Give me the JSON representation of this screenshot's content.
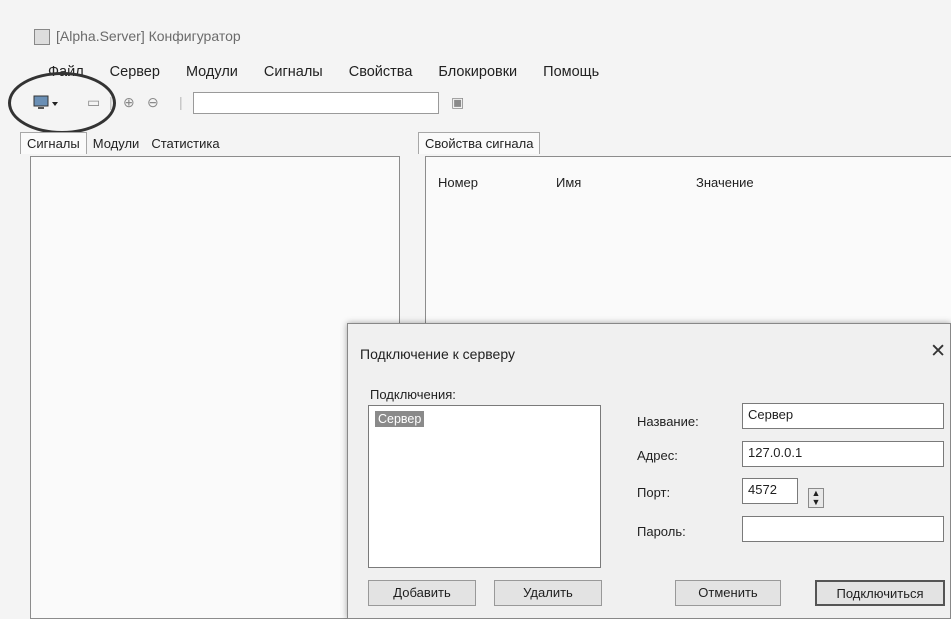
{
  "window": {
    "title": "[Alpha.Server] Конфигуратор"
  },
  "menu": {
    "items": [
      "Файл",
      "Сервер",
      "Модули",
      "Сигналы",
      "Свойства",
      "Блокировки",
      "Помощь"
    ]
  },
  "left_tabs": [
    "Сигналы",
    "Модули",
    "Статистика"
  ],
  "right": {
    "tab": "Свойства сигнала",
    "columns": [
      "Номер",
      "Имя",
      "Значение"
    ]
  },
  "dialog": {
    "title": "Подключение к серверу",
    "connections_label": "Подключения:",
    "connections": [
      "Сервер"
    ],
    "fields": {
      "name_label": "Название:",
      "name_value": "Сервер",
      "address_label": "Адрес:",
      "address_value": "127.0.0.1",
      "port_label": "Порт:",
      "port_value": "4572",
      "password_label": "Пароль:",
      "password_value": ""
    },
    "buttons": {
      "add": "Добавить",
      "delete": "Удалить",
      "cancel": "Отменить",
      "connect": "Подключиться"
    }
  }
}
